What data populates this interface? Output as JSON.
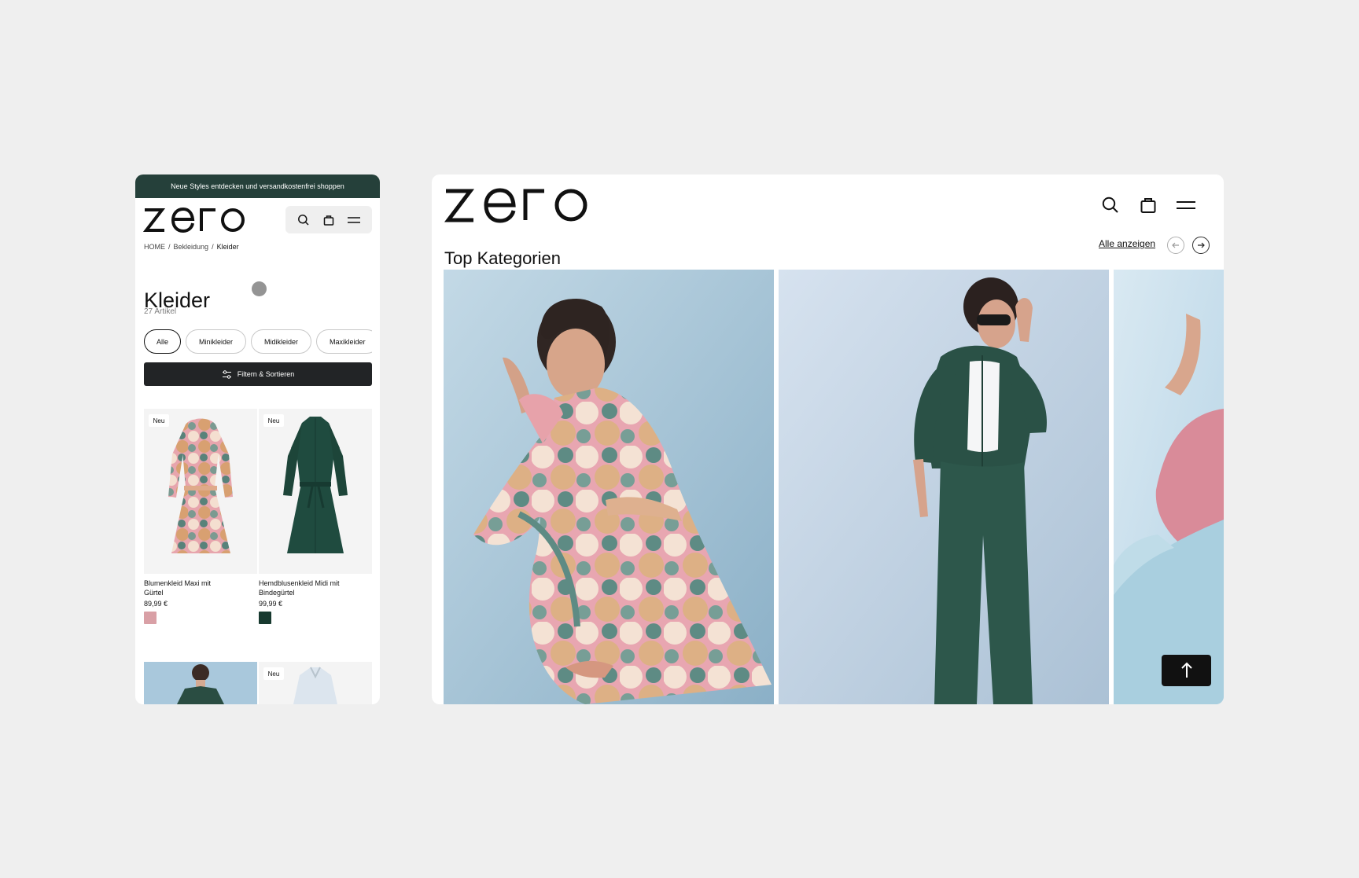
{
  "mobile": {
    "promo_text": "Neue Styles entdecken und versandkostenfrei shoppen",
    "logo_text": "zero",
    "breadcrumb": {
      "home": "HOME",
      "separator": "/",
      "parent": "Bekleidung",
      "current": "Kleider"
    },
    "page_title": "Kleider",
    "article_count": "27 Artikel",
    "chips": [
      {
        "label": "Alle",
        "active": true
      },
      {
        "label": "Minikleider",
        "active": false
      },
      {
        "label": "Midikleider",
        "active": false
      },
      {
        "label": "Maxikleider",
        "active": false
      }
    ],
    "filter_label": "Filtern & Sortieren",
    "products": [
      {
        "badge": "Neu",
        "name": "Blumenkleid Maxi mit Gürtel",
        "price": "89,99 €",
        "swatch_color": "#d9a0a6"
      },
      {
        "badge": "Neu",
        "name": "Hemdblusenkleid Midi mit Bindegürtel",
        "price": "99,99 €",
        "swatch_color": "#17392f"
      }
    ],
    "bottom_products": [
      {
        "badge": ""
      },
      {
        "badge": "Neu"
      }
    ]
  },
  "desktop": {
    "logo_text": "zero",
    "section_title": "Top Kategorien",
    "view_all_label": "Alle anzeigen"
  },
  "colors": {
    "page_bg": "#efefef",
    "promo_bg": "#25403a",
    "button_dark": "#222426",
    "accent_green": "#2b5248",
    "photo_blue": "#9fc0d6"
  },
  "icons": {
    "search": "search-icon",
    "bag": "shopping-bag-icon",
    "menu": "menu-icon",
    "filter": "sliders-icon",
    "arrow_left": "arrow-left-icon",
    "arrow_right": "arrow-right-icon",
    "arrow_up": "arrow-up-icon"
  }
}
